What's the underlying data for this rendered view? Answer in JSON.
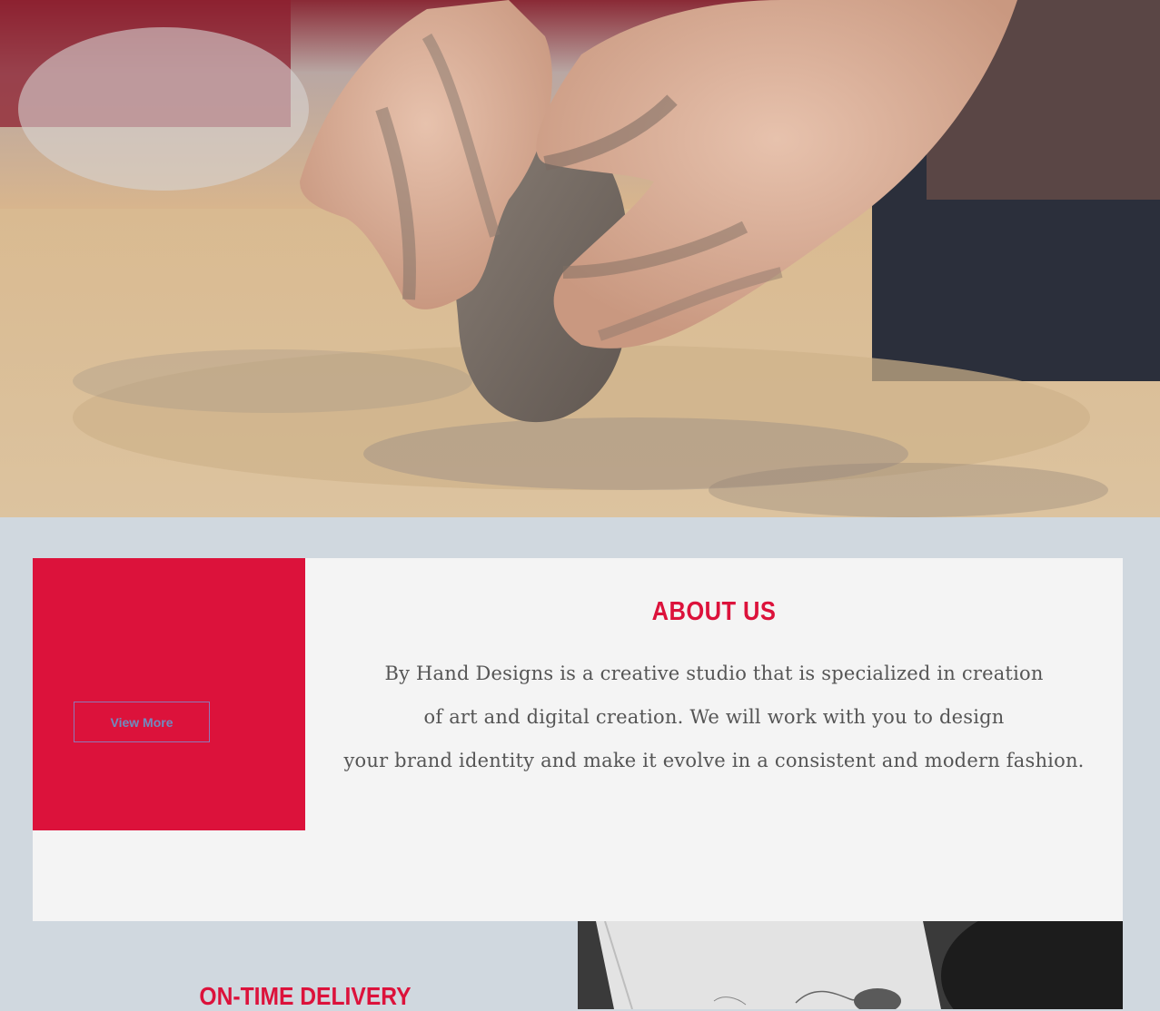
{
  "hero": {
    "image_alt": "Clay-covered hands shaping a lump of clay on a wooden table"
  },
  "about": {
    "title": "ABOUT US",
    "paragraph_lines": [
      "By Hand Designs is a creative studio that is specialized in creation",
      "of art and digital creation. We will work with you to design",
      "your brand identity and make it evolve in a consistent and modern fashion."
    ],
    "button_label": "View More"
  },
  "delivery": {
    "title": "ON-TIME DELIVERY"
  },
  "colors": {
    "accent": "#dc123b",
    "band_bg": "#d0d8df",
    "panel_bg": "#f4f4f4"
  }
}
